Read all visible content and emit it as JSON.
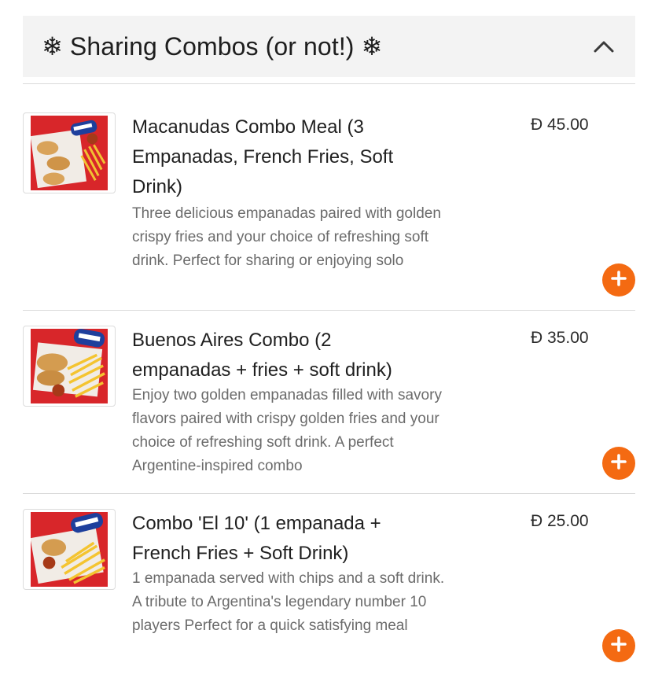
{
  "section": {
    "title": "❄ Sharing Combos (or not!) ❄",
    "toggle_icon": "chevron-up-icon"
  },
  "colors": {
    "accent": "#f46a12",
    "header_bg": "#f3f3f3",
    "divider": "#d9d9d9",
    "desc_text": "#6b6b6b"
  },
  "items": [
    {
      "name": "Macanudas Combo Meal (3 Empanadas, French Fries, Soft Drink)",
      "description": "Three delicious empanadas paired with golden crispy fries and your choice of refreshing soft drink. Perfect for sharing or enjoying solo",
      "price": "Đ 45.00",
      "add_icon": "plus-icon"
    },
    {
      "name": "Buenos Aires Combo (2 empanadas + fries + soft drink)",
      "description": "Enjoy two golden empanadas filled with savory flavors paired with crispy golden fries and your choice of refreshing soft drink. A perfect Argentine-inspired combo",
      "price": "Đ 35.00",
      "add_icon": "plus-icon"
    },
    {
      "name": "Combo 'El 10' (1 empanada + French Fries + Soft Drink)",
      "description": "1 empanada served with chips and a soft drink. A tribute to Argentina's legendary number 10 players Perfect for a quick satisfying meal",
      "price": "Đ 25.00",
      "add_icon": "plus-icon"
    }
  ]
}
